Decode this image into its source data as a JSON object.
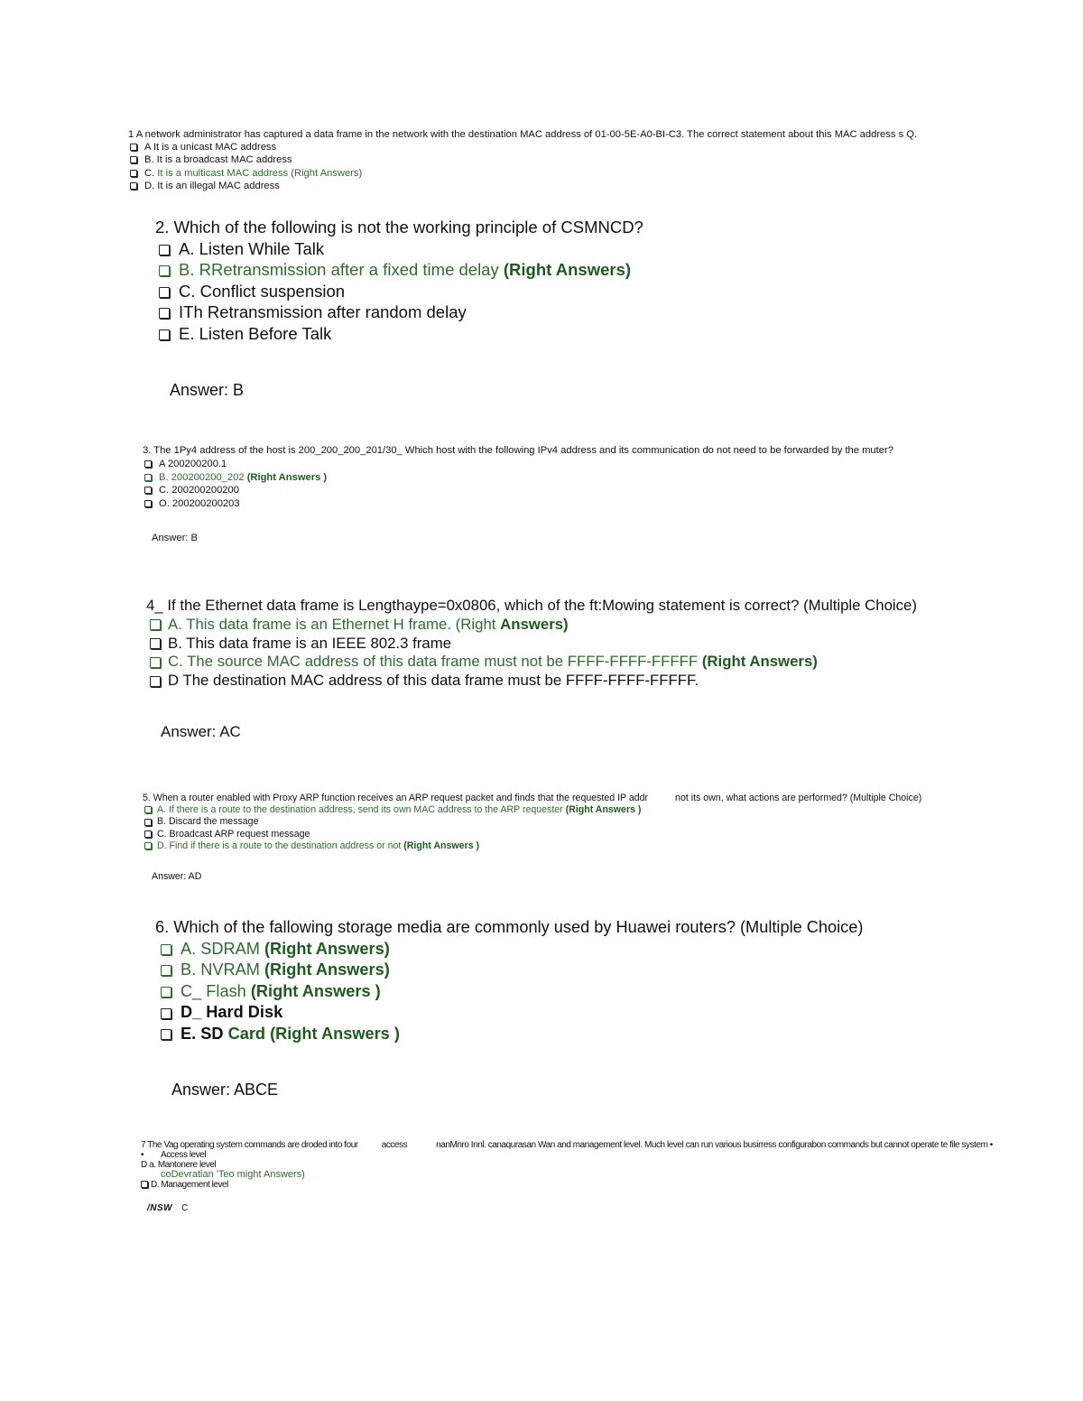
{
  "document": {
    "colors": {
      "text": "#111111",
      "answer_green": "#2e6b2e",
      "answer_green_bold": "#1f5a1f",
      "background": "#ffffff"
    },
    "questions": [
      {
        "number": "1",
        "text": "1 A network administrator has captured a data frame in the network with the destination MAC address of 01-00-5E-A0-BI-C3. The correct statement about this MAC address s Q.",
        "options": [
          {
            "label": "A It is a unicast MAC address"
          },
          {
            "label": "B. It is a broadcast MAC address"
          },
          {
            "prefix": "C. ",
            "label": "It is a multicast MAC address (Right Answers)",
            "correct": true
          },
          {
            "label": "D. It is an illegal MAC address"
          }
        ]
      },
      {
        "number": "2",
        "text": "2. Which of the following is not the working principle of CSMNCD?",
        "options": [
          {
            "label": "A. Listen While Talk"
          },
          {
            "label": "B. RRetransmission after a fixed time delay",
            "tag": "(Right Answers)",
            "correct": true
          },
          {
            "label": "C. Conflict suspension"
          },
          {
            "label": "ITh Retransmission after random delay"
          },
          {
            "label": "E. Listen Before Talk"
          }
        ],
        "answer": "Answer: B"
      },
      {
        "number": "3",
        "text": "3. The 1Py4 address of the host is 200_200_200_201/30_ Which host with the following IPv4 address and its communication do not need to be forwarded by the muter?",
        "options": [
          {
            "label": "A 200200200.1"
          },
          {
            "label": "B. 200200200_202",
            "tag": "(Right Answers )",
            "correct": true
          },
          {
            "label": "C. 200200200200"
          },
          {
            "label": "O. 200200200203"
          }
        ],
        "answer": "Answer:  B"
      },
      {
        "number": "4",
        "text": "4_ If the Ethernet data frame is Lengthaype=0x0806, which of the ft:Mowing statement is correct? (Multiple Choice)",
        "options": [
          {
            "label": "A. This data frame is an Ethernet H frame. (Right",
            "tag": "Answers)",
            "correct": true
          },
          {
            "label": "B. This data frame is an IEEE 802.3 frame"
          },
          {
            "label": "C. The source MAC address of this data frame must not be FFFF-FFFF-FFFFF",
            "tag": "(Right Answers)",
            "correct": true
          },
          {
            "label": "D The destination MAC address of this data frame must be FFFF-FFFF-FFFFF."
          }
        ],
        "answer": "Answer: AC"
      },
      {
        "number": "5",
        "text_part1": "5. When a router enabled with Proxy ARP function receives an ARP request packet and finds that the requested IP addr",
        "text_part2": "not its own, what actions are performed? (Multiple Choice)",
        "options": [
          {
            "label": "A. If there is a route to the destination address, send its own MAC address to the ARP requester",
            "tag": "(Right Answers )",
            "correct": true
          },
          {
            "label": "B. Discard the message"
          },
          {
            "label": "C. Broadcast ARP request message"
          },
          {
            "label": "D. Find if there is a route to the destination address or not",
            "tag": "(Right Answers )",
            "correct": true
          }
        ],
        "answer": "Answer: AD"
      },
      {
        "number": "6",
        "text": "6. Which of the fallowing storage media are commonly used by Huawei routers? (Multiple Choice)",
        "options": [
          {
            "label": "A. SDRAM",
            "tag": "(Right Answers)",
            "correct": true
          },
          {
            "label": "B. NVRAM",
            "tag": "(Right Answers)",
            "correct": true
          },
          {
            "label": "C_ Flash",
            "tag": "(Right Answers )",
            "correct": true
          },
          {
            "label": "D_ Hard Disk"
          },
          {
            "prefix": "E. SD",
            "label": "Card (Right Answers )",
            "correct": true
          }
        ],
        "answer": "Answer: ABCE"
      },
      {
        "number": "7",
        "text_part1": "7 The Vag operating system commands are droded into four",
        "text_part2": "access",
        "text_part3": "nanMnro Innl. canaqurasan Wan and management level. Much level can run various busirress configurabon commands but cannot operate te file system •",
        "options": [
          {
            "bullet": "•",
            "label": "Access level"
          },
          {
            "bullet": "D",
            "label": "a. Mantonere level"
          },
          {
            "label": "coDevratian 'Teo might Answers)",
            "correct": true
          },
          {
            "label": "D. Management level"
          }
        ],
        "answer_prefix": "/NSW",
        "answer_value": "C"
      }
    ]
  }
}
